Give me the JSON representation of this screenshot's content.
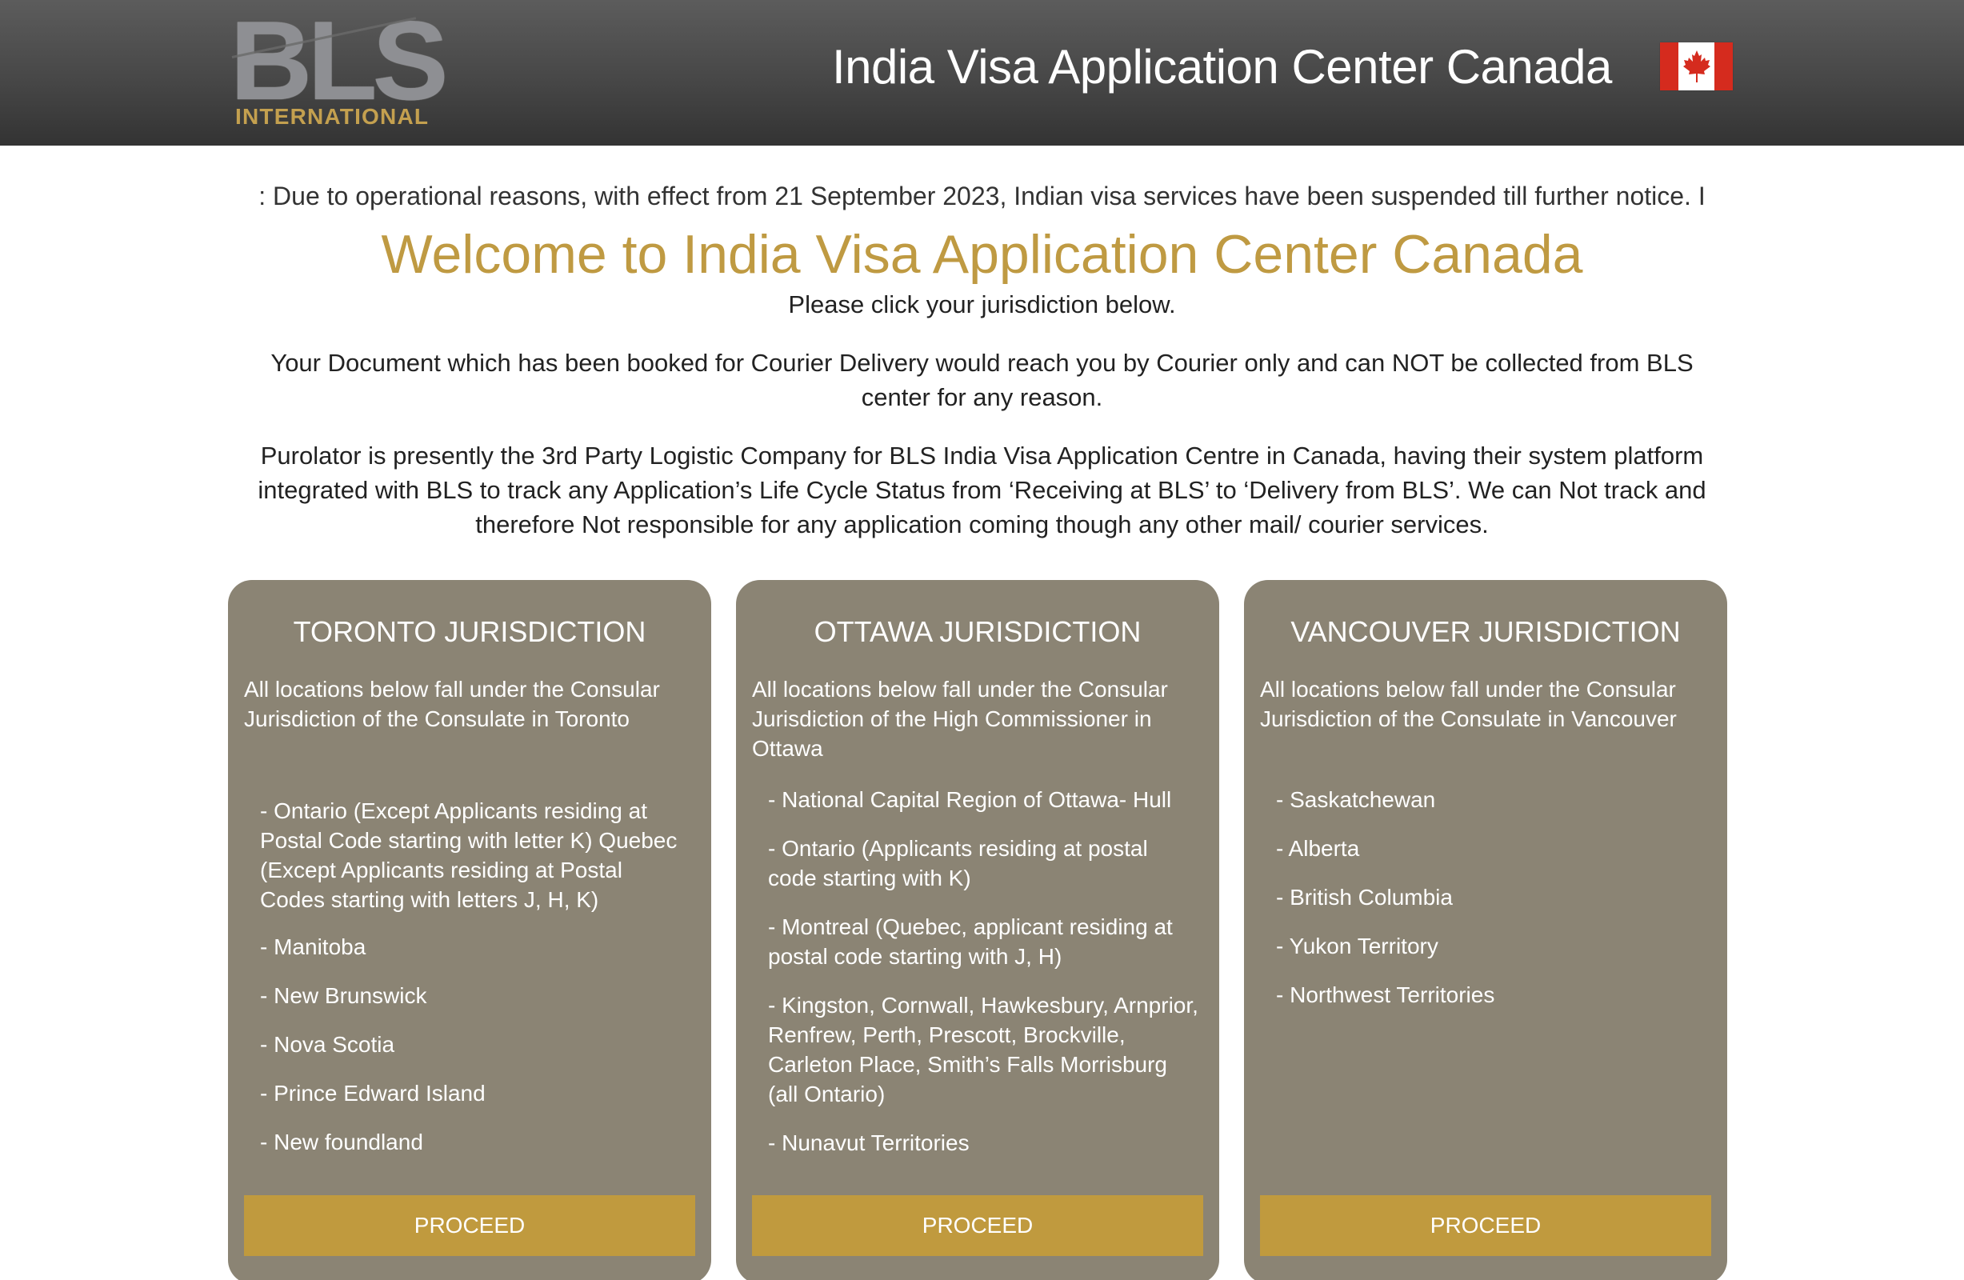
{
  "header": {
    "logo": {
      "main": "BLS",
      "sub": "INTERNATIONAL"
    },
    "title": "India Visa Application Center Canada",
    "flag_icon": "canada-flag-icon",
    "colors": {
      "flag_red": "#d52b1e"
    }
  },
  "notice": ": Due to operational reasons, with effect from 21 September 2023, Indian visa services have been suspended till further notice. I",
  "welcome": "Welcome to India Visa Application Center Canada",
  "instruction": "Please click your jurisdiction below.",
  "paragraphs": [
    "Your Document which has been booked for Courier Delivery would reach you by Courier only and can NOT be collected from BLS center for any reason.",
    "Purolator is presently the 3rd Party Logistic Company for BLS India Visa Application Centre in Canada, having their system platform integrated with BLS to track any Application’s Life Cycle Status from ‘Receiving at BLS’ to ‘Delivery from BLS’. We can Not track and therefore Not responsible for any application coming though any other mail/ courier services."
  ],
  "colors": {
    "accent_gold": "#bf9a42",
    "card_bg": "#8b8474",
    "button_bg": "#c09a3e"
  },
  "jurisdictions": [
    {
      "title": "TORONTO JURISDICTION",
      "description": "All locations below fall under the Consular Jurisdiction of the Consulate in Toronto",
      "items": [
        "- Ontario (Except Applicants residing at Postal Code starting with letter K) Quebec (Except Applicants residing at Postal Codes starting with letters J, H, K)",
        "- Manitoba",
        "- New Brunswick",
        "- Nova Scotia",
        "- Prince Edward Island",
        "- New foundland"
      ],
      "button": "PROCEED"
    },
    {
      "title": "OTTAWA JURISDICTION",
      "description": "All locations below fall under the Consular Jurisdiction of the High Commissioner in Ottawa",
      "items": [
        "- National Capital Region of Ottawa- Hull",
        "- Ontario (Applicants residing at postal code starting with K)",
        "- Montreal (Quebec, applicant residing at postal code starting with J, H)",
        "- Kingston, Cornwall, Hawkesbury, Arnprior, Renfrew, Perth, Prescott, Brockville, Carleton Place, Smith’s Falls Morrisburg (all Ontario)",
        "- Nunavut Territories"
      ],
      "button": "PROCEED"
    },
    {
      "title": "VANCOUVER JURISDICTION",
      "description": "All locations below fall under the Consular Jurisdiction of the Consulate in Vancouver",
      "items": [
        "- Saskatchewan",
        "- Alberta",
        "- British Columbia",
        "- Yukon Territory",
        "- Northwest Territories"
      ],
      "button": "PROCEED"
    }
  ]
}
